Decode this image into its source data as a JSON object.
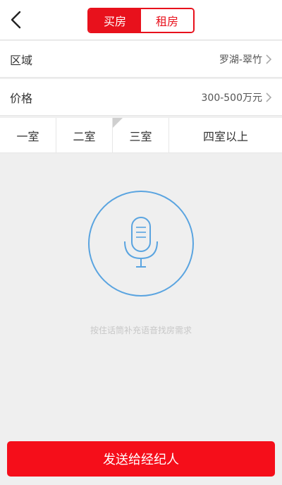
{
  "header": {
    "back_icon": "chevron-left-icon",
    "tabs": [
      {
        "label": "买房",
        "active": true
      },
      {
        "label": "租房",
        "active": false
      }
    ]
  },
  "filters": {
    "area": {
      "label": "区域",
      "value": "罗湖-翠竹"
    },
    "price": {
      "label": "价格",
      "value": "300-500万元"
    }
  },
  "rooms": [
    {
      "label": "一室"
    },
    {
      "label": "二室"
    },
    {
      "label": "三室"
    },
    {
      "label": "四室以上"
    }
  ],
  "voice": {
    "icon": "microphone-icon",
    "hint": "按住话筒补充语音找房需求"
  },
  "send_button": "发送给经纪人",
  "colors": {
    "accent": "#e8111c",
    "mic_blue": "#5aa4e0",
    "background": "#efefef"
  }
}
